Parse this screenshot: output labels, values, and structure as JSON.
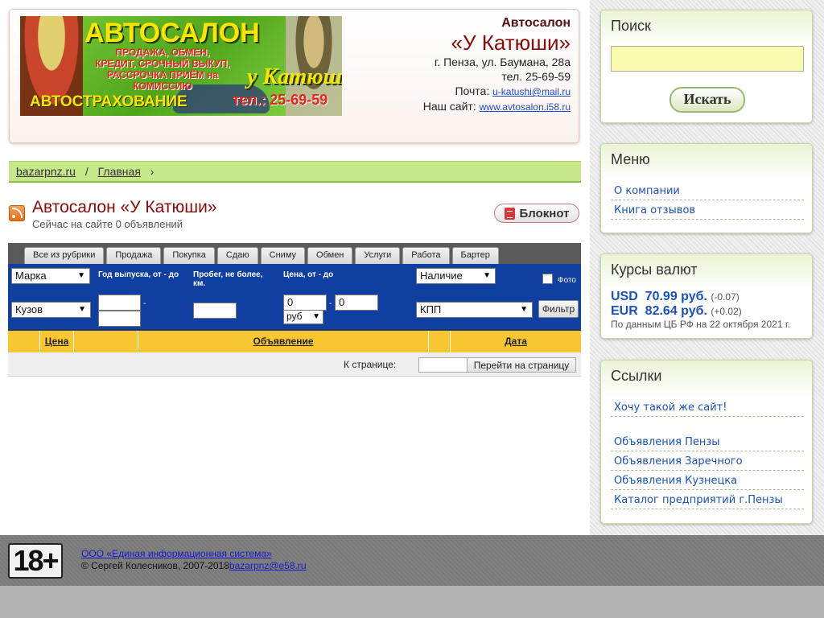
{
  "header": {
    "banner": {
      "title": "АВТОСАЛОН",
      "services": "ПРОДАЖА, ОБМЕН, КРЕДИТ, СРОЧНЫЙ ВЫКУП, РАССРОЧКА ПРИЁМ на КОМИССИЮ",
      "insurance": "АВТОСТРАХОВАНИЕ",
      "brand": "у Катюши",
      "phone": "тел.: 25-69-59"
    },
    "label": "Автосалон",
    "name": "«У Катюши»",
    "address": "г. Пенза, ул. Баумана, 28а",
    "phone": "тел. 25-69-59",
    "email_label": "Почта:",
    "email": "u-katushi@mail.ru",
    "site_label": "Наш сайт:",
    "site": "www.avtosalon.i58.ru"
  },
  "breadcrumb": {
    "items": [
      "bazarpnz.ru",
      "Главная"
    ],
    "separator": "/",
    "trail": "›"
  },
  "page": {
    "title": "Автосалон «У Катюши»",
    "subtitle": "Сейчас на сайте 0 объявлений",
    "notepad_label": "Блокнот"
  },
  "tabs": [
    "Все из рубрики",
    "Продажа",
    "Покупка",
    "Сдаю",
    "Сниму",
    "Обмен",
    "Услуги",
    "Работа",
    "Бартер"
  ],
  "filters": {
    "make": "Марка",
    "body": "Кузов",
    "year_label": "Год выпуска, от - до",
    "year_dash": "-",
    "mileage_label": "Пробег, не более, км.",
    "price_label": "Цена, от - до",
    "price_from": "0",
    "price_to": "0",
    "price_dash": "-",
    "currency": "руб",
    "availability": "Наличие",
    "gearbox": "КПП",
    "photo_label": "Фото",
    "filter_button": "Фильтр"
  },
  "table": {
    "columns": [
      "Цена",
      "Объявление",
      "Дата"
    ],
    "to_page_label": "К странице:",
    "goto_button": "Перейти на страницу"
  },
  "sidebar": {
    "search": {
      "title": "Поиск",
      "button": "Искать"
    },
    "menu": {
      "title": "Меню",
      "items": [
        "О компании",
        "Книга отзывов"
      ]
    },
    "rates": {
      "title": "Курсы валют",
      "usd": {
        "code": "USD",
        "value": "70.99 руб.",
        "change": "(-0.07)"
      },
      "eur": {
        "code": "EUR",
        "value": "82.64 руб.",
        "change": "(+0.02)"
      },
      "source": "По данным ЦБ РФ на 22 октября 2021 г."
    },
    "links": {
      "title": "Ссылки",
      "items": [
        "Хочу такой же сайт!",
        "Объявления Пензы",
        "Объявления Заречного",
        "Объявления Кузнецка",
        "Каталог предприятий г.Пензы"
      ]
    }
  },
  "footer": {
    "age_badge": "18+",
    "company": "ООО «Единая информационная система»",
    "copyright": "© Сергей Колесников, 2007-2018",
    "email": "bazarpnz@e58.ru"
  },
  "colors": {
    "brand_red": "#8b0a0a",
    "breadcrumb_green": "#c6e88a",
    "filter_blue": "#0f3fa0",
    "table_header_yellow": "#f8c630",
    "link_blue": "#1a52b8"
  }
}
